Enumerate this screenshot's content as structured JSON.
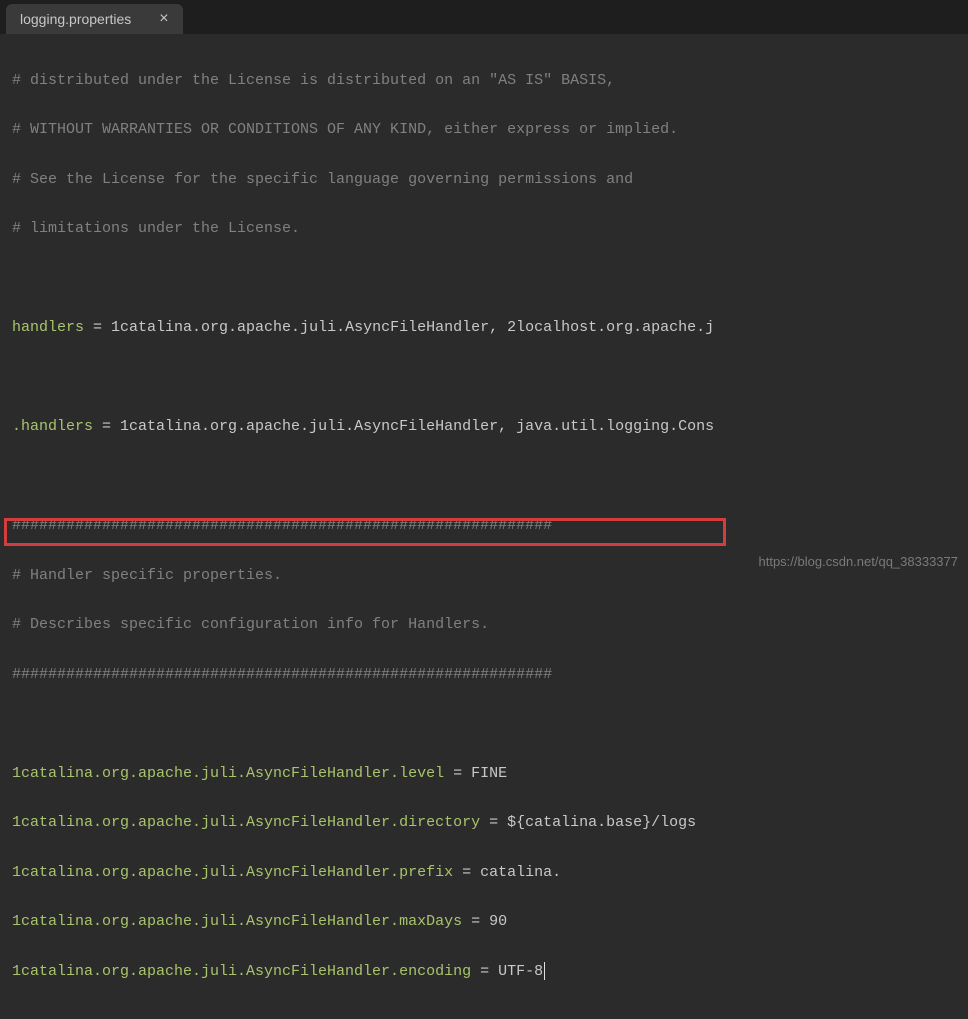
{
  "tab": {
    "filename": "logging.properties",
    "close_symbol": "×"
  },
  "lines": {
    "l1": "# distributed under the License is distributed on an \"AS IS\" BASIS,",
    "l2": "# WITHOUT WARRANTIES OR CONDITIONS OF ANY KIND, either express or implied.",
    "l3": "# See the License for the specific language governing permissions and",
    "l4": "# limitations under the License.",
    "l6_key": "handlers ",
    "l6_eq": "= ",
    "l6_val": "1catalina.org.apache.juli.AsyncFileHandler, 2localhost.org.apache.j",
    "l8_key": ".handlers ",
    "l8_eq": "= ",
    "l8_val": "1catalina.org.apache.juli.AsyncFileHandler, java.util.logging.Cons",
    "l10": "############################################################",
    "l11": "# Handler specific properties.",
    "l12": "# Describes specific configuration info for Handlers.",
    "l13": "############################################################",
    "l15_key": "1catalina.org.apache.juli.AsyncFileHandler.level ",
    "l15_eq": "= ",
    "l15_val": "FINE",
    "l16_key": "1catalina.org.apache.juli.AsyncFileHandler.directory ",
    "l16_eq": "= ",
    "l16_val": "${catalina.base}/logs",
    "l17_key": "1catalina.org.apache.juli.AsyncFileHandler.prefix ",
    "l17_eq": "= ",
    "l17_val": "catalina.",
    "l18_key": "1catalina.org.apache.juli.AsyncFileHandler.maxDays ",
    "l18_eq": "= ",
    "l18_val": "90",
    "l19_key": "1catalina.org.apache.juli.AsyncFileHandler.encoding ",
    "l19_eq": "= ",
    "l19_val": "UTF-8"
  },
  "watermark": "https://blog.csdn.net/qq_38333377"
}
